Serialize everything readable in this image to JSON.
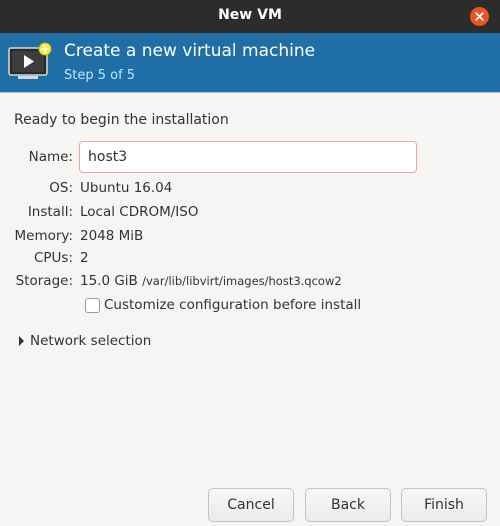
{
  "window": {
    "title": "New VM"
  },
  "banner": {
    "heading": "Create a new virtual machine",
    "step": "Step 5 of 5"
  },
  "form": {
    "intro": "Ready to begin the installation",
    "name_label": "Name:",
    "name_value": "host3",
    "os_label": "OS:",
    "os_value": "Ubuntu 16.04",
    "install_label": "Install:",
    "install_value": "Local CDROM/ISO",
    "memory_label": "Memory:",
    "memory_value": "2048 MiB",
    "cpus_label": "CPUs:",
    "cpus_value": "2",
    "storage_label": "Storage:",
    "storage_size": "15.0 GiB",
    "storage_path": "/var/lib/libvirt/images/host3.qcow2",
    "customize_label": "Customize configuration before install",
    "customize_checked": false,
    "network_label": "Network selection"
  },
  "buttons": {
    "cancel": "Cancel",
    "back": "Back",
    "finish": "Finish"
  },
  "colors": {
    "banner": "#1f6fa6",
    "titlebar": "#2c2c2c",
    "close": "#e95420"
  }
}
